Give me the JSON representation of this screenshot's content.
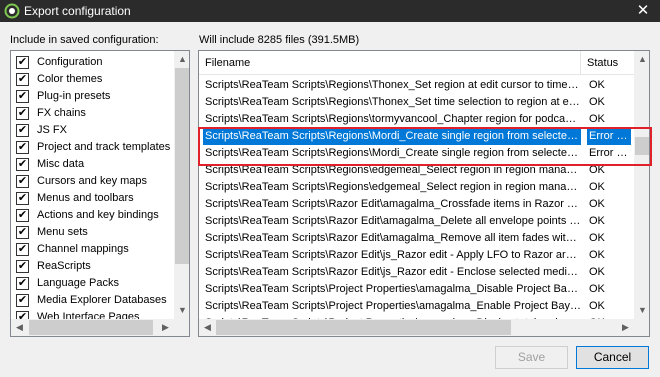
{
  "window": {
    "title": "Export configuration",
    "close_glyph": "✕",
    "app_icon": "reaper-icon"
  },
  "left_panel": {
    "label": "Include in saved configuration:",
    "items": [
      {
        "label": "Configuration",
        "checked": true
      },
      {
        "label": "Color themes",
        "checked": true
      },
      {
        "label": "Plug-in presets",
        "checked": true
      },
      {
        "label": "FX chains",
        "checked": true
      },
      {
        "label": "JS FX",
        "checked": true
      },
      {
        "label": "Project and track templates",
        "checked": true
      },
      {
        "label": "Misc data",
        "checked": true
      },
      {
        "label": "Cursors and key maps",
        "checked": true
      },
      {
        "label": "Menus and toolbars",
        "checked": true
      },
      {
        "label": "Actions and key bindings",
        "checked": true
      },
      {
        "label": "Menu sets",
        "checked": true
      },
      {
        "label": "Channel mappings",
        "checked": true
      },
      {
        "label": "ReaScripts",
        "checked": true
      },
      {
        "label": "Language Packs",
        "checked": true
      },
      {
        "label": "Media Explorer Databases",
        "checked": true
      },
      {
        "label": "Web Interface Pages",
        "checked": true
      }
    ]
  },
  "right_panel": {
    "summary": "Will include 8285 files (391.5MB)",
    "columns": {
      "filename": "Filename",
      "status": "Status"
    },
    "rows": [
      {
        "filename": "Scripts\\ReaTeam Scripts\\Regions\\Thonex_Set region at edit cursor to time s...",
        "status": "OK",
        "selected": false
      },
      {
        "filename": "Scripts\\ReaTeam Scripts\\Regions\\Thonex_Set time selection to region at edi...",
        "status": "OK",
        "selected": false
      },
      {
        "filename": "Scripts\\ReaTeam Scripts\\Regions\\tormyvancool_Chapter region for podcast...",
        "status": "OK",
        "selected": false
      },
      {
        "filename": "Scripts\\ReaTeam Scripts\\Regions\\Mordi_Create single region from selected i...",
        "status": "Error read",
        "selected": true
      },
      {
        "filename": "Scripts\\ReaTeam Scripts\\Regions\\Mordi_Create single region from selected i...",
        "status": "Error read",
        "selected": false
      },
      {
        "filename": "Scripts\\ReaTeam Scripts\\Regions\\edgemeal_Select region in region manage...",
        "status": "OK",
        "selected": false
      },
      {
        "filename": "Scripts\\ReaTeam Scripts\\Regions\\edgemeal_Select region in region manage...",
        "status": "OK",
        "selected": false
      },
      {
        "filename": "Scripts\\ReaTeam Scripts\\Razor Edit\\amagalma_Crossfade items in Razor Edit...",
        "status": "OK",
        "selected": false
      },
      {
        "filename": "Scripts\\ReaTeam Scripts\\Razor Edit\\amagalma_Delete all envelope points in...",
        "status": "OK",
        "selected": false
      },
      {
        "filename": "Scripts\\ReaTeam Scripts\\Razor Edit\\amagalma_Remove all item fades within...",
        "status": "OK",
        "selected": false
      },
      {
        "filename": "Scripts\\ReaTeam Scripts\\Razor Edit\\js_Razor edit - Apply LFO to Razor areas...",
        "status": "OK",
        "selected": false
      },
      {
        "filename": "Scripts\\ReaTeam Scripts\\Razor Edit\\js_Razor edit - Enclose selected media i...",
        "status": "OK",
        "selected": false
      },
      {
        "filename": "Scripts\\ReaTeam Scripts\\Project Properties\\amagalma_Disable Project Bay o...",
        "status": "OK",
        "selected": false
      },
      {
        "filename": "Scripts\\ReaTeam Scripts\\Project Properties\\amagalma_Enable Project Bay o...",
        "status": "OK",
        "selected": false
      },
      {
        "filename": "Scripts\\ReaTeam Scripts\\Project Properties\\amagalma_Display total project...",
        "status": "OK",
        "selected": false
      }
    ]
  },
  "buttons": {
    "save": "Save",
    "cancel": "Cancel"
  },
  "colors": {
    "selection": "#0078d7",
    "annotation": "#e0202a",
    "titlebar": "#2b2b2b"
  }
}
